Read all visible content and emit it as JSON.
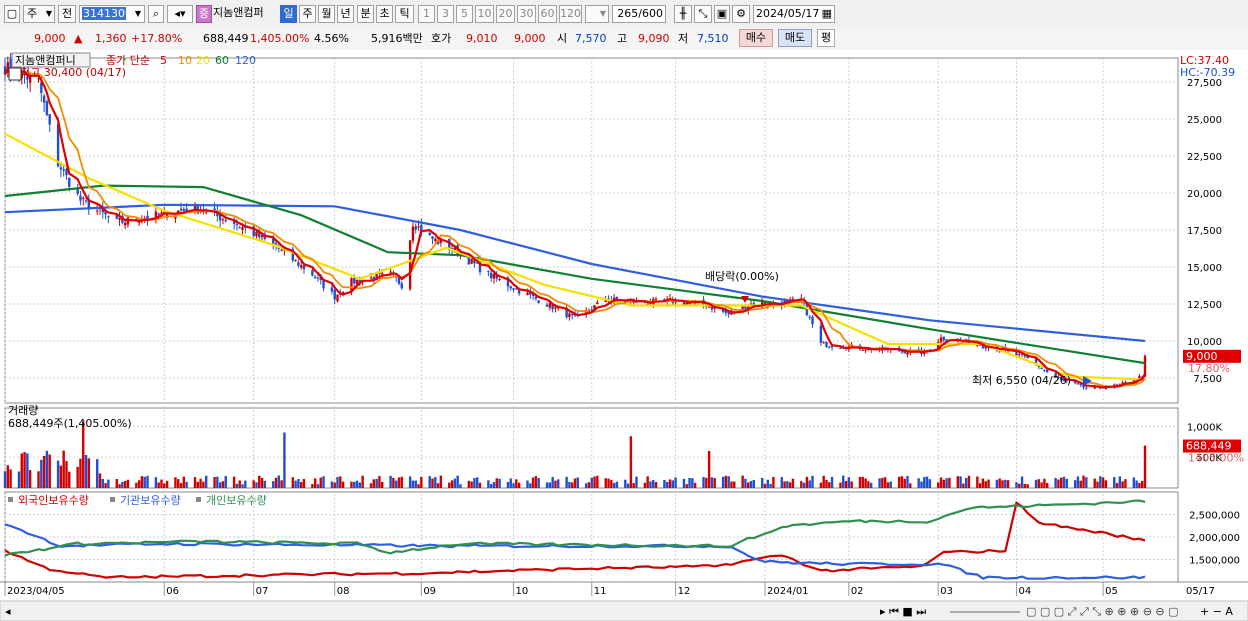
{
  "toolbar": {
    "period_unit": "주",
    "prev_label": "전",
    "stock_code": "314130",
    "stock_badge": "증",
    "stock_name": "지놈앤컴퍼",
    "tab_day": "일",
    "tab_week": "주",
    "tab_month": "월",
    "tab_year": "년",
    "tab_minute": "분",
    "tab_second": "초",
    "tab_tick": "틱",
    "intervals": [
      "1",
      "3",
      "5",
      "10",
      "20",
      "30",
      "60",
      "120"
    ],
    "count": "265",
    "count_max": "/600",
    "date": "2024/05/17"
  },
  "quote": {
    "price": "9,000",
    "arrow": "▲",
    "change": "1,360",
    "change_pct": "+17.80%",
    "volume": "688,449",
    "volume_pct": "1,405.00%",
    "turnover_pct": "4.56%",
    "amount": "5,916백만",
    "bid_label": "호가",
    "bid1": "9,010",
    "bid2": "9,000",
    "open_label": "시",
    "open": "7,570",
    "high_label": "고",
    "high": "9,090",
    "low_label": "저",
    "low": "7,510",
    "buy_label": "매수",
    "sell_label": "매도",
    "avg_label": "평"
  },
  "chart_data": [
    {
      "type": "candlestick",
      "title": "지놈앤컴퍼니",
      "legend": {
        "price_label": "종가 단순",
        "ma_periods": [
          "5",
          "10",
          "20",
          "60",
          "120"
        ]
      },
      "ma_colors": {
        "5": "#e00000",
        "10": "#f08c00",
        "20": "#f5e000",
        "60": "#108030",
        "120": "#2f5fe0"
      },
      "max_note": "최고 30,400 (04/17)",
      "min_note": "최저 6,550 (04/26)",
      "dividend_note": "배당락(0.00%)",
      "lc_label": "LC:37.40",
      "hc_label": "HC:-70.39",
      "price_box": "9,000",
      "price_pct_box": "17.80%",
      "y_ticks": [
        "27,500",
        "25,000",
        "22,500",
        "20,000",
        "17,500",
        "15,000",
        "12,500",
        "10,000",
        "7,500"
      ],
      "y_range": [
        5000,
        30000
      ],
      "x_ticks": [
        "2023/04/05",
        "06",
        "07",
        "08",
        "09",
        "10",
        "11",
        "12",
        "2024/01",
        "02",
        "03",
        "04",
        "05",
        "05/17"
      ],
      "close_path": [
        [
          "2023/04/05",
          28500
        ],
        [
          "2023/04/17",
          27500
        ],
        [
          "2023/04/24",
          22000
        ],
        [
          "2023/05/02",
          19500
        ],
        [
          "2023/05/15",
          18000
        ],
        [
          "2023/05/30",
          18500
        ],
        [
          "2023/06/12",
          19000
        ],
        [
          "2023/06/26",
          18000
        ],
        [
          "2023/07/10",
          16500
        ],
        [
          "2023/07/24",
          14500
        ],
        [
          "2023/08/01",
          13000
        ],
        [
          "2023/08/07",
          14000
        ],
        [
          "2023/08/21",
          14500
        ],
        [
          "2023/08/25",
          13800
        ],
        [
          "2023/08/29",
          18000
        ],
        [
          "2023/09/04",
          17000
        ],
        [
          "2023/09/14",
          16000
        ],
        [
          "2023/09/25",
          14500
        ],
        [
          "2023/10/05",
          13500
        ],
        [
          "2023/10/16",
          12500
        ],
        [
          "2023/10/26",
          11500
        ],
        [
          "2023/11/06",
          12800
        ],
        [
          "2023/11/20",
          12600
        ],
        [
          "2023/11/30",
          12700
        ],
        [
          "2023/12/11",
          12500
        ],
        [
          "2023/12/20",
          11800
        ],
        [
          "2023/12/28",
          12500
        ],
        [
          "2024/01/10",
          12600
        ],
        [
          "2024/01/15",
          12800
        ],
        [
          "2024/01/22",
          9800
        ],
        [
          "2024/02/01",
          9600
        ],
        [
          "2024/02/15",
          9400
        ],
        [
          "2024/02/28",
          9200
        ],
        [
          "2024/03/05",
          10200
        ],
        [
          "2024/03/15",
          9900
        ],
        [
          "2024/03/25",
          9500
        ],
        [
          "2024/04/05",
          8800
        ],
        [
          "2024/04/15",
          7500
        ],
        [
          "2024/04/26",
          6800
        ],
        [
          "2024/05/08",
          7000
        ],
        [
          "2024/05/16",
          7640
        ],
        [
          "2024/05/17",
          9000
        ]
      ],
      "ma120_path": [
        [
          "2023/04/05",
          18700
        ],
        [
          "2023/06/01",
          19200
        ],
        [
          "2023/08/01",
          19100
        ],
        [
          "2023/09/15",
          17500
        ],
        [
          "2023/11/01",
          15200
        ],
        [
          "2024/01/01",
          13000
        ],
        [
          "2024/03/01",
          11400
        ],
        [
          "2024/05/17",
          10000
        ]
      ],
      "ma60_path": [
        [
          "2023/04/05",
          19800
        ],
        [
          "2023/05/10",
          20500
        ],
        [
          "2023/06/15",
          20400
        ],
        [
          "2023/07/20",
          18500
        ],
        [
          "2023/08/20",
          16000
        ],
        [
          "2023/09/15",
          15800
        ],
        [
          "2023/11/01",
          14200
        ],
        [
          "2024/01/01",
          12700
        ],
        [
          "2024/03/01",
          10800
        ],
        [
          "2024/05/17",
          8500
        ]
      ],
      "ma20_path": [
        [
          "2023/04/05",
          24000
        ],
        [
          "2023/05/05",
          21000
        ],
        [
          "2023/06/01",
          18800
        ],
        [
          "2023/07/10",
          16500
        ],
        [
          "2023/08/10",
          14200
        ],
        [
          "2023/09/10",
          16300
        ],
        [
          "2023/10/15",
          13800
        ],
        [
          "2023/11/15",
          12400
        ],
        [
          "2023/12/20",
          12400
        ],
        [
          "2024/01/15",
          12400
        ],
        [
          "2024/02/15",
          9800
        ],
        [
          "2024/03/20",
          9800
        ],
        [
          "2024/04/20",
          7600
        ],
        [
          "2024/05/17",
          7400
        ]
      ]
    },
    {
      "type": "bar",
      "title": "거래량",
      "volume_label": "688,449주(1,405.00%)",
      "y_ticks": [
        "1,000K",
        "500K"
      ],
      "box_value": "688,449",
      "box_pct": "1405.00%",
      "last_value": 688449
    },
    {
      "type": "line",
      "legend": [
        {
          "name": "외국인보유수량",
          "color": "#d00000"
        },
        {
          "name": "기관보유수량",
          "color": "#2f5fe0"
        },
        {
          "name": "개인보유수량",
          "color": "#309050"
        }
      ],
      "y_ticks": [
        "2,500,000",
        "2,000,000",
        "1,500,000"
      ],
      "y_range": [
        1000000,
        3000000
      ]
    }
  ]
}
